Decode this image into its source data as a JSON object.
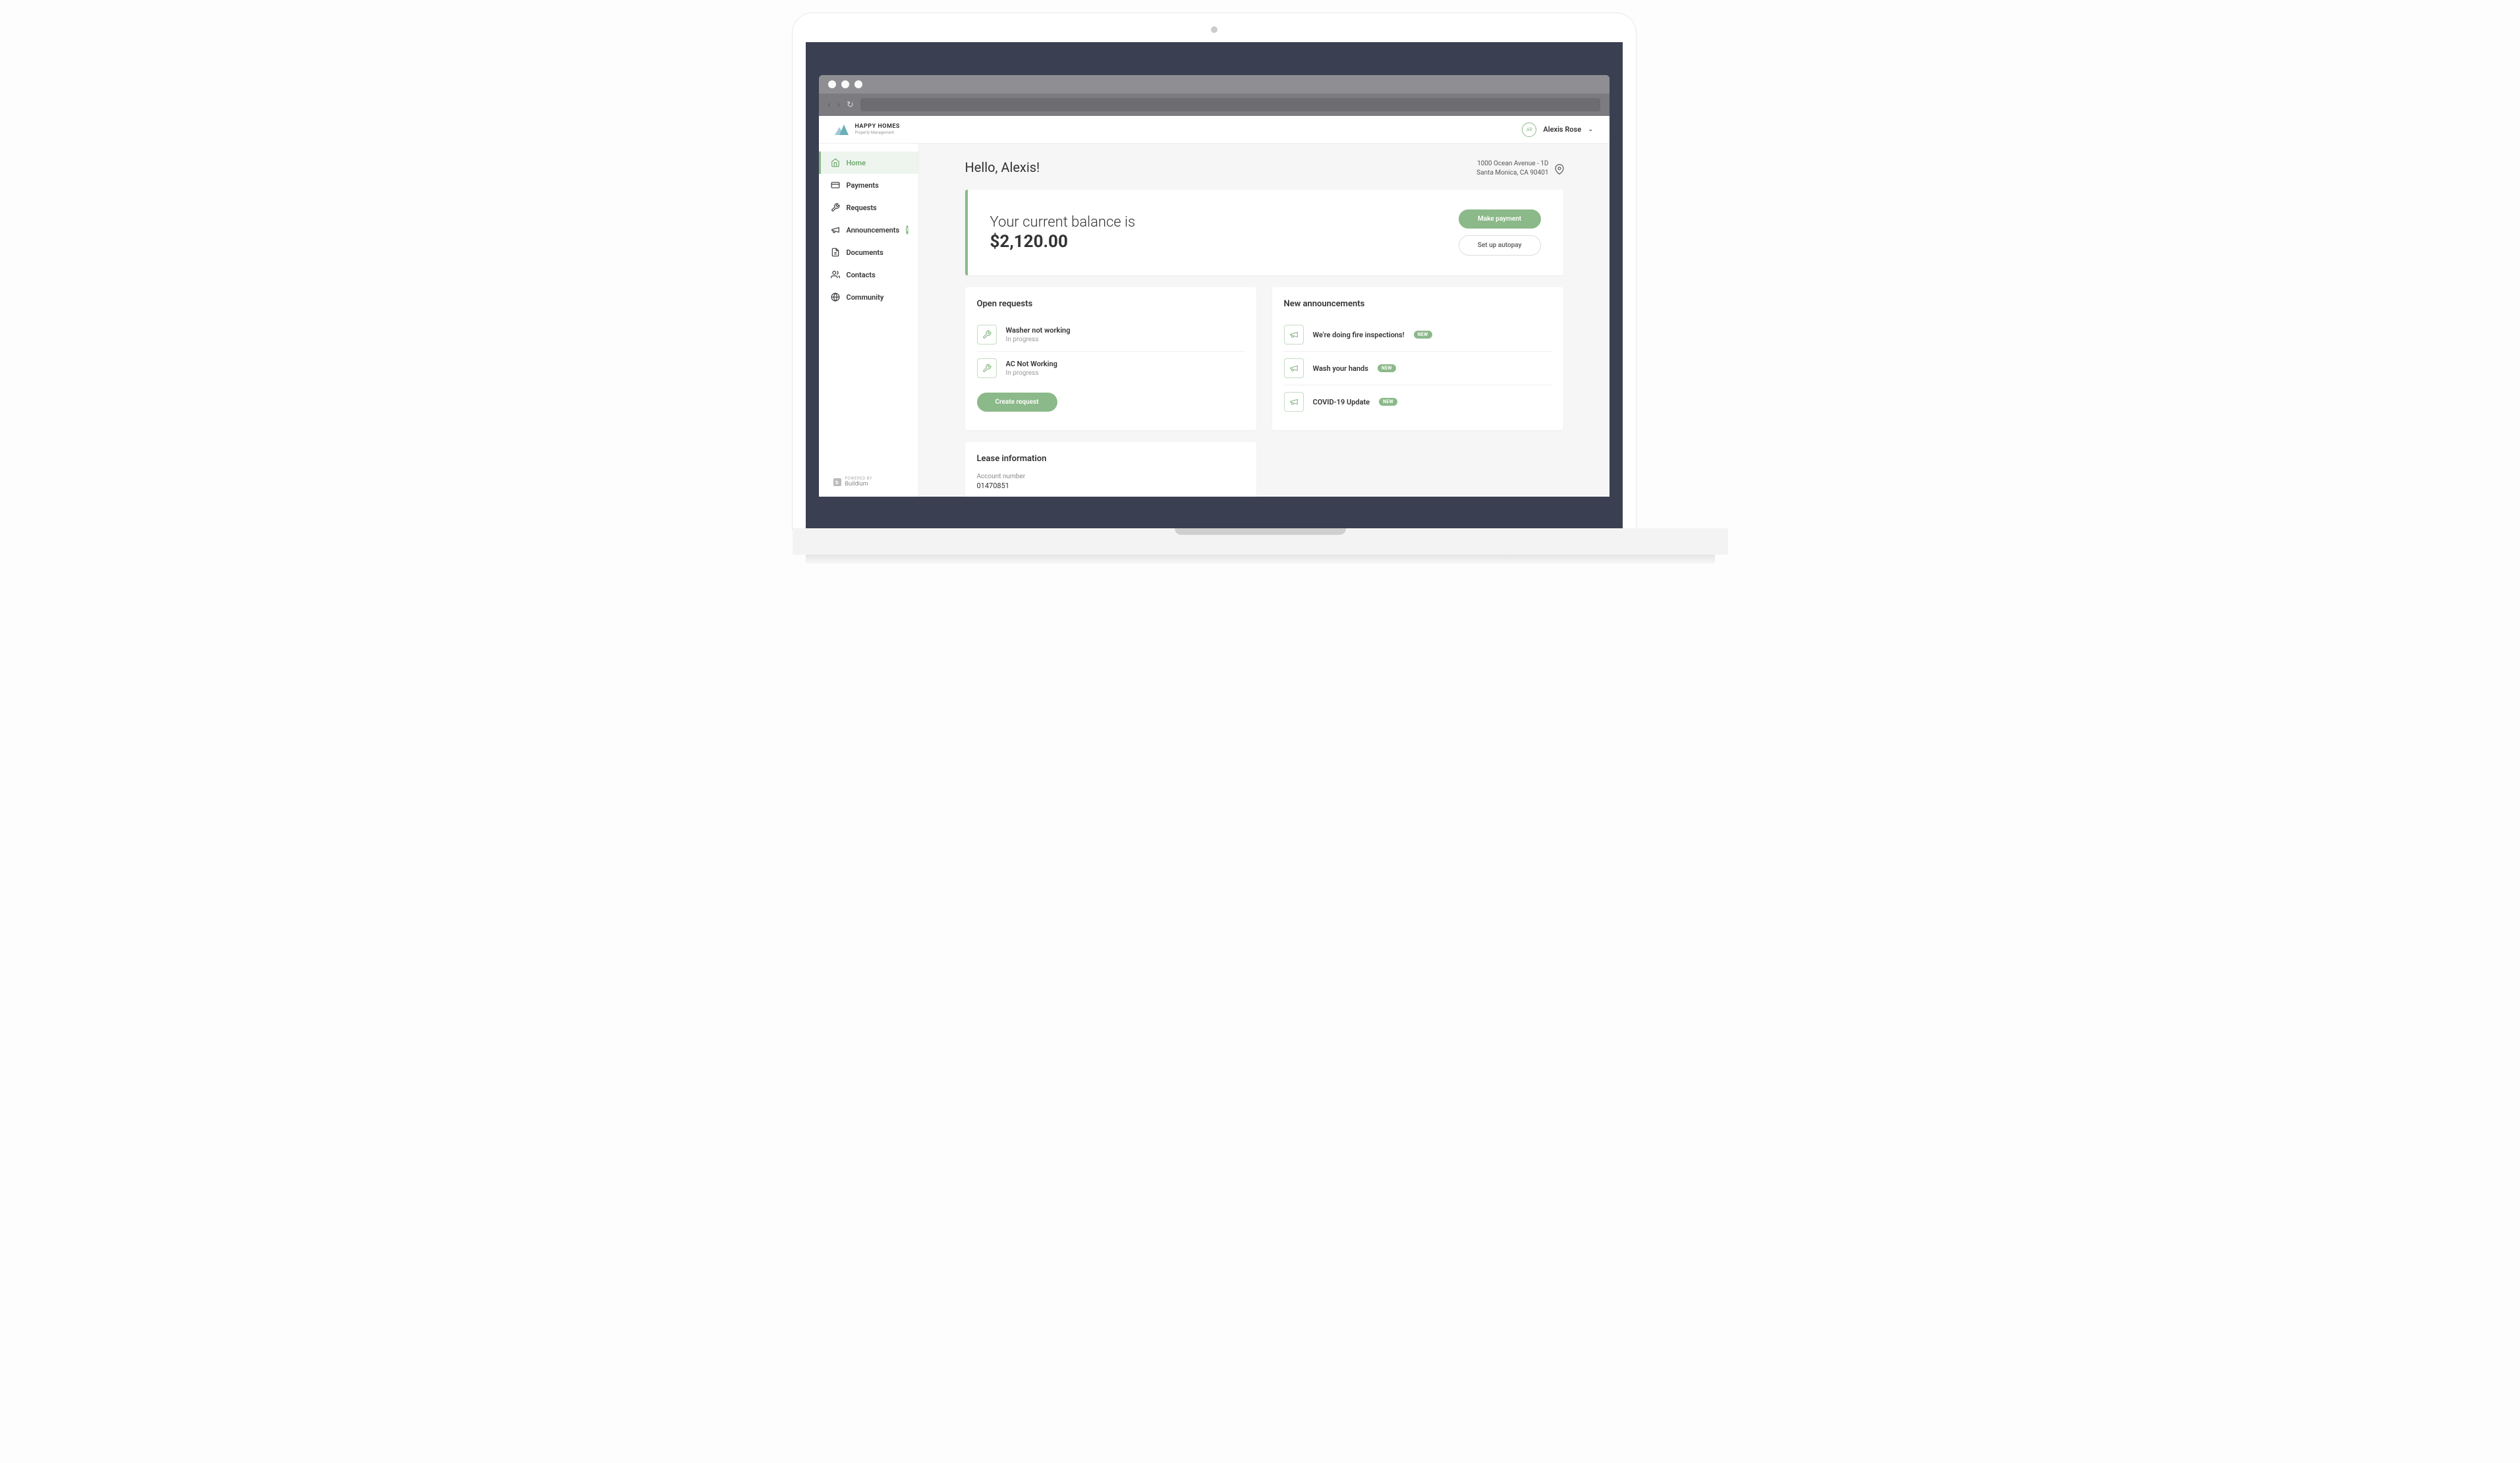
{
  "company": {
    "name": "HAPPY HOMES",
    "subtitle": "Property Management"
  },
  "user": {
    "initials": "AR",
    "name": "Alexis Rose"
  },
  "sidebar": {
    "items": [
      {
        "label": "Home"
      },
      {
        "label": "Payments"
      },
      {
        "label": "Requests"
      },
      {
        "label": "Announcements",
        "badge": "3"
      },
      {
        "label": "Documents"
      },
      {
        "label": "Contacts"
      },
      {
        "label": "Community"
      }
    ]
  },
  "powered": {
    "label": "POWERED BY",
    "name": "Buildium"
  },
  "page": {
    "greeting": "Hello, Alexis!",
    "address_line1": "1000 Ocean Avenue - 1D",
    "address_line2": "Santa Monica, CA 90401"
  },
  "balance": {
    "label": "Your current balance is",
    "amount": "$2,120.00",
    "primary_btn": "Make payment",
    "secondary_btn": "Set up autopay"
  },
  "requests": {
    "title": "Open requests",
    "items": [
      {
        "title": "Washer not working",
        "status": "In progress"
      },
      {
        "title": "AC Not Working",
        "status": "In progress"
      }
    ],
    "create_btn": "Create request"
  },
  "announcements": {
    "title": "New announcements",
    "items": [
      {
        "title": "We're doing fire inspections!",
        "badge": "NEW"
      },
      {
        "title": "Wash your hands",
        "badge": "NEW"
      },
      {
        "title": "COVID-19 Update",
        "badge": "NEW"
      }
    ]
  },
  "lease": {
    "title": "Lease information",
    "account_label": "Account number",
    "account_value": "01470851"
  }
}
